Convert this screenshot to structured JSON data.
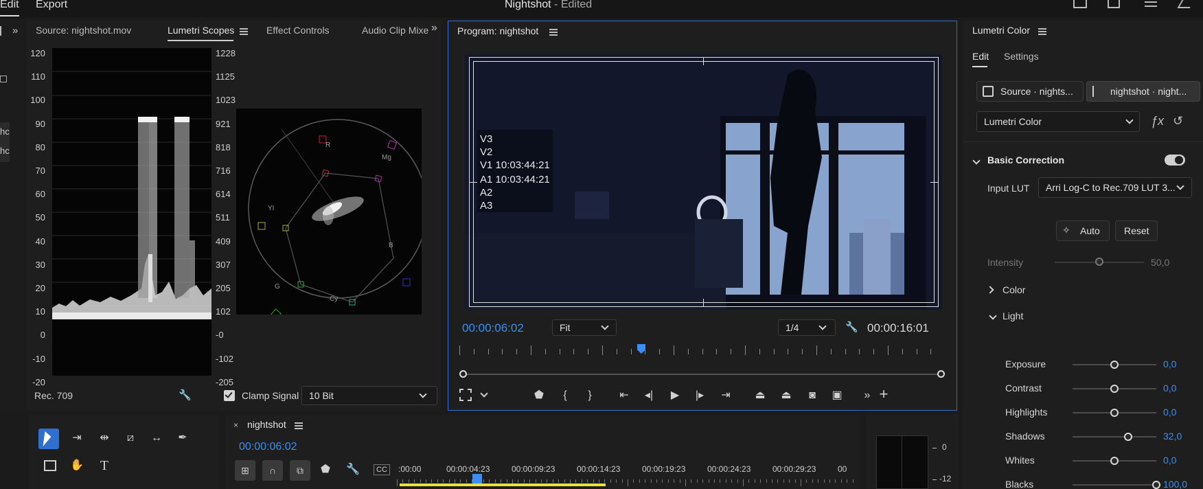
{
  "menu": {
    "edit": "Edit",
    "export": "Export"
  },
  "window": {
    "title": "Nightshot",
    "subtitle": "- Edited"
  },
  "source_panel": {
    "tabs": [
      "Source: nightshot.mov",
      "Lumetri Scopes",
      "Effect Controls",
      "Audio Clip Mixe"
    ],
    "left_scale": [
      "120",
      "110",
      "100",
      "90",
      "80",
      "70",
      "60",
      "50",
      "40",
      "30",
      "20",
      "10",
      "0",
      "-10",
      "-20"
    ],
    "right_scale": [
      "1228",
      "1125",
      "1023",
      "921",
      "818",
      "716",
      "614",
      "511",
      "409",
      "307",
      "205",
      "102",
      "-0",
      "-102",
      "-205"
    ],
    "vectorscope_labels": [
      "R",
      "Mg",
      "YI",
      "B",
      "G",
      "Cy"
    ],
    "colorspace": "Rec. 709",
    "clamp_signal": "Clamp Signal",
    "clamp_checked": true,
    "bit_depth": "10 Bit"
  },
  "program": {
    "title": "Program: nightshot",
    "overlay": [
      "V3",
      "V2",
      "V1 10:03:44:21",
      "A1 10:03:44:21",
      "A2",
      "A3"
    ],
    "timecode": "00:00:06:02",
    "fit": "Fit",
    "resolution": "1/4",
    "duration": "00:00:16:01",
    "playhead_fraction": 0.37
  },
  "lumetri": {
    "title": "Lumetri Color",
    "tabs": [
      "Edit",
      "Settings"
    ],
    "source_btn": "Source · nights...",
    "clip_btn": "nightshot · night...",
    "effect": "Lumetri Color",
    "section": "Basic Correction",
    "input_lut_label": "Input LUT",
    "input_lut": "Arri Log-C to Rec.709 LUT 3...",
    "auto": "Auto",
    "reset": "Reset",
    "intensity": {
      "label": "Intensity",
      "value": "50,0",
      "fraction": 0.5
    },
    "color_section": "Color",
    "light_section": "Light",
    "sliders": [
      {
        "label": "Exposure",
        "value": "0,0",
        "fraction": 0.5
      },
      {
        "label": "Contrast",
        "value": "0,0",
        "fraction": 0.5
      },
      {
        "label": "Highlights",
        "value": "0,0",
        "fraction": 0.5
      },
      {
        "label": "Shadows",
        "value": "32,0",
        "fraction": 0.66
      },
      {
        "label": "Whites",
        "value": "0,0",
        "fraction": 0.5
      },
      {
        "label": "Blacks",
        "value": "100,0",
        "fraction": 1.0
      }
    ]
  },
  "timeline": {
    "sequence": "nightshot",
    "timecode": "00:00:06:02",
    "ruler": [
      ":00:00",
      "00:00:04:23",
      "00:00:09:23",
      "00:00:14:23",
      "00:00:19:23",
      "00:00:24:23",
      "00:00:29:23",
      "00"
    ]
  },
  "audio_meter": {
    "ticks": [
      "0",
      "-12"
    ]
  },
  "colors": {
    "accent": "#3b8ef5",
    "panel": "#1e1e1e",
    "highlight_border": "#2f6fd0",
    "timeline_bar": "#e8e23a"
  }
}
